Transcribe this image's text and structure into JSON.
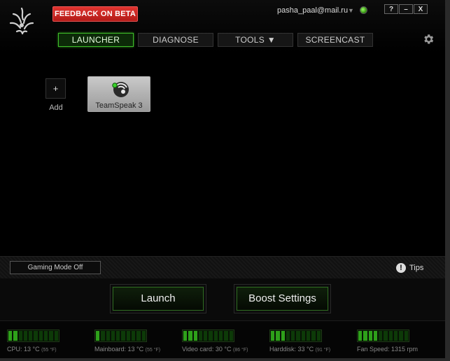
{
  "header": {
    "feedback_label": "FEEDBACK ON BETA",
    "user_email": "pasha_paal@mail.ru",
    "window_buttons": [
      "?",
      "–",
      "X"
    ]
  },
  "tabs": [
    {
      "label": "LAUNCHER",
      "active": true
    },
    {
      "label": "DIAGNOSE",
      "active": false
    },
    {
      "label": "TOOLS ▼",
      "active": false
    },
    {
      "label": "SCREENCAST",
      "active": false
    }
  ],
  "launcher": {
    "add_symbol": "+",
    "add_label": "Add",
    "apps": [
      {
        "label": "TeamSpeak 3",
        "icon": "teamspeak-icon"
      }
    ]
  },
  "mode_bar": {
    "gaming_mode_label": "Gaming Mode Off",
    "tips_label": "Tips"
  },
  "actions": {
    "launch_label": "Launch",
    "boost_label": "Boost Settings"
  },
  "monitors": [
    {
      "name": "CPU: 13 °C",
      "fahrenheit": "(55 °F)",
      "level": 0.15
    },
    {
      "name": "Mainboard: 13 °C",
      "fahrenheit": "(55 °F)",
      "level": 0.1
    },
    {
      "name": "Video card: 30 °C",
      "fahrenheit": "(86 °F)",
      "level": 0.3
    },
    {
      "name": "Harddisk: 33 °C",
      "fahrenheit": "(91 °F)",
      "level": 0.3
    },
    {
      "name": "Fan Speed: 1315 rpm",
      "fahrenheit": "",
      "level": 0.35
    }
  ],
  "colors": {
    "accent_green": "#3fbf2a",
    "feedback_red": "#d0302a",
    "status_green": "#5fd22c"
  }
}
